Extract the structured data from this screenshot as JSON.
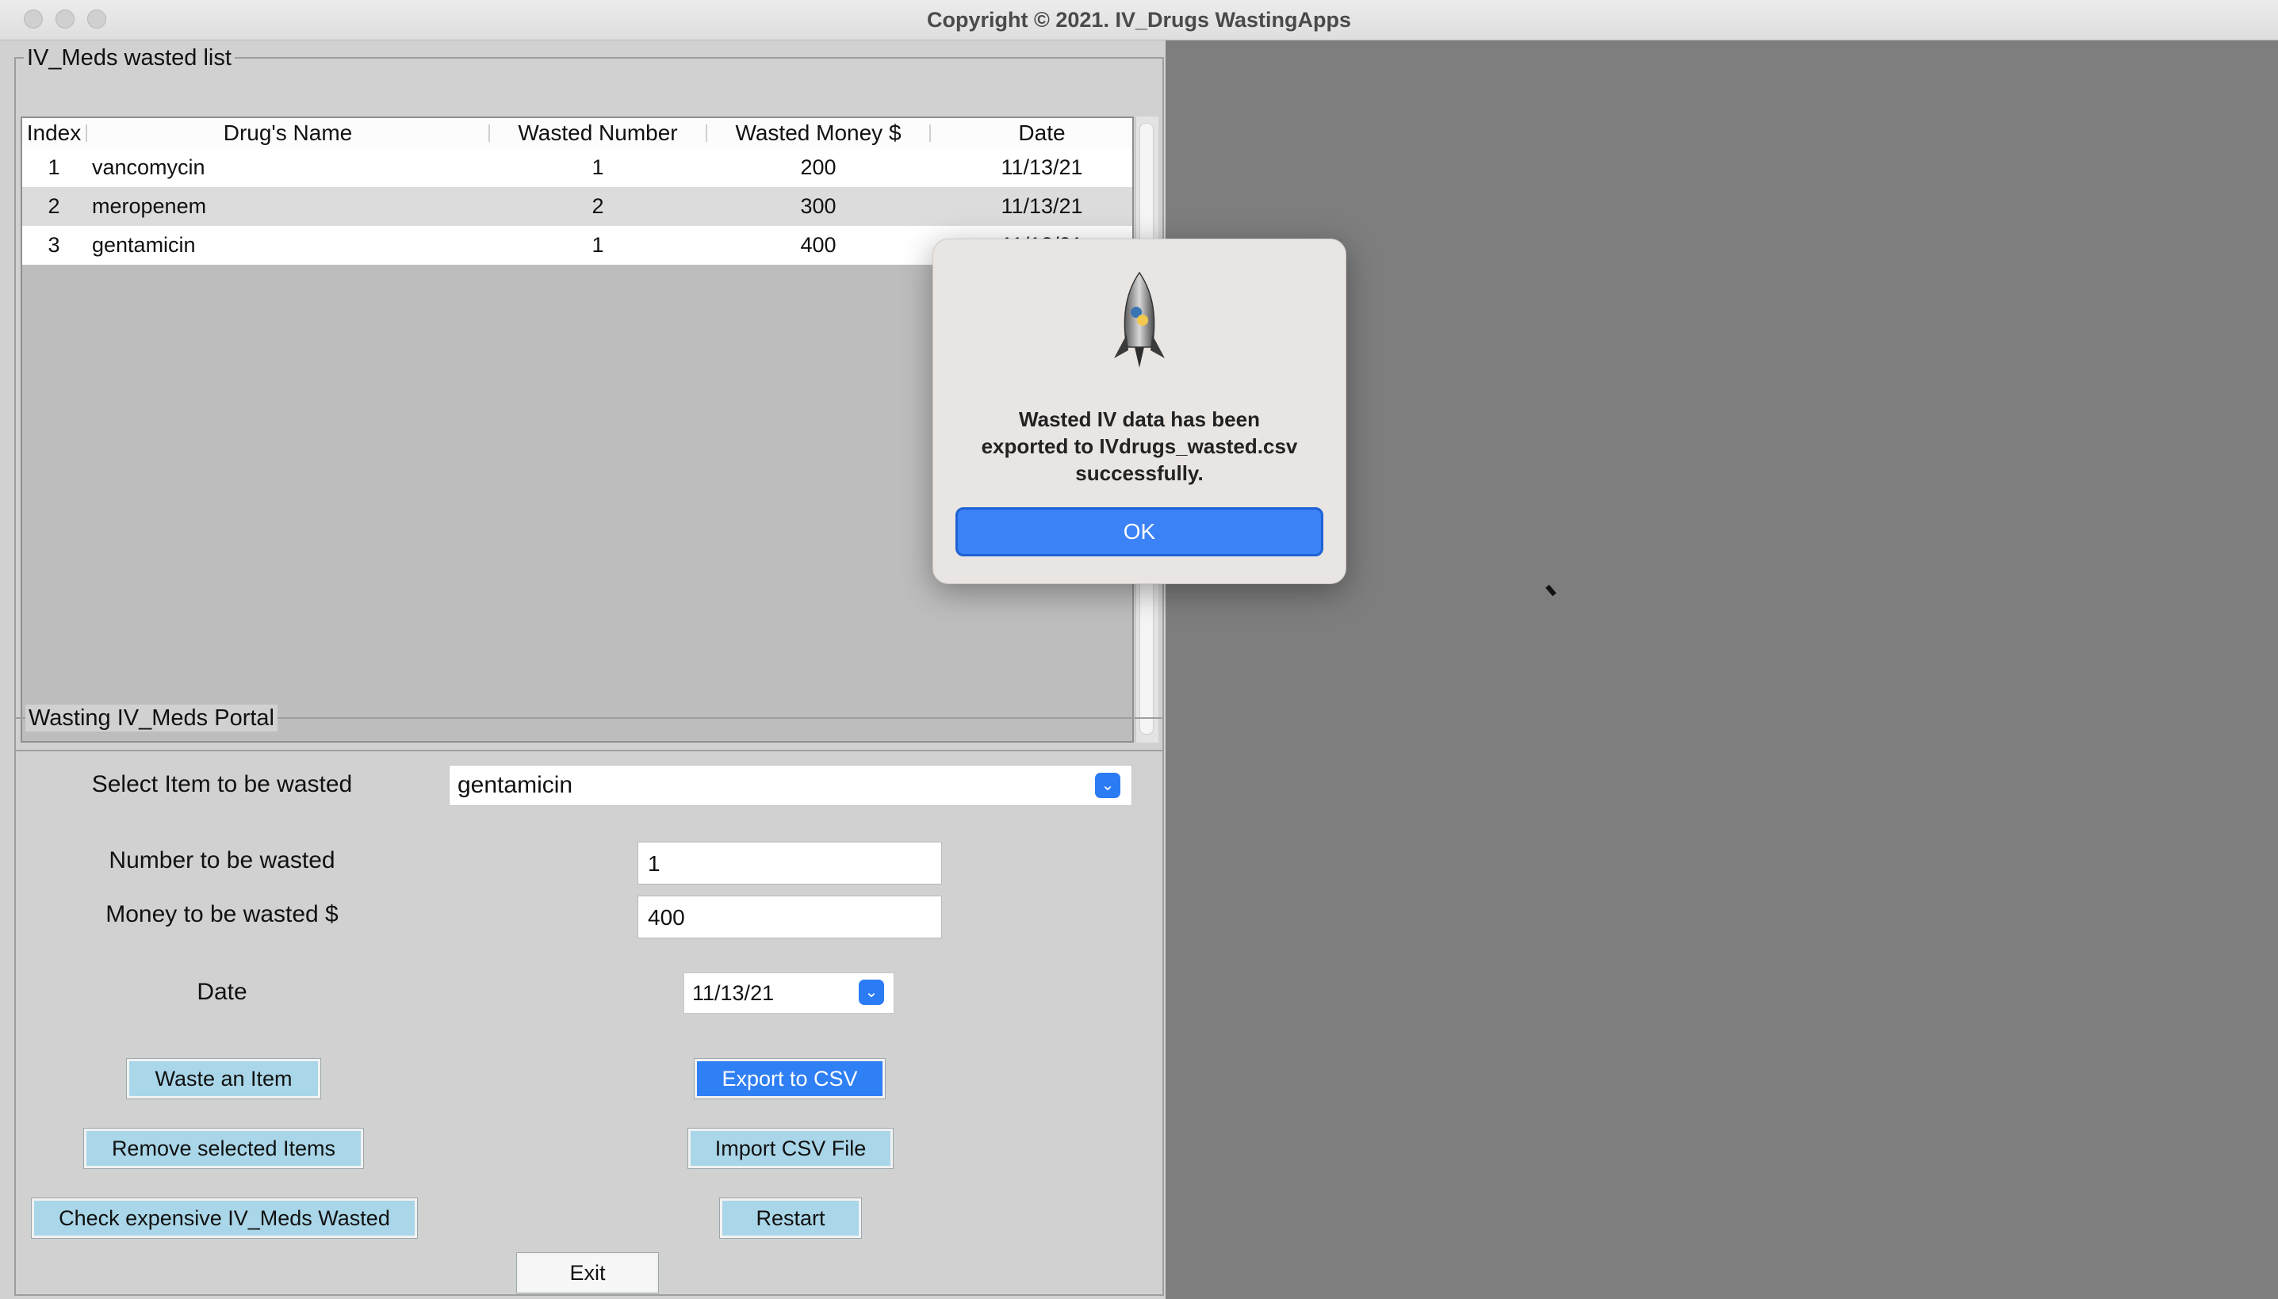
{
  "window": {
    "title": "Copyright © 2021. IV_Drugs WastingApps"
  },
  "list_group": {
    "label": "IV_Meds wasted list"
  },
  "table": {
    "columns": [
      "Index",
      "Drug's Name",
      "Wasted Number",
      "Wasted Money $",
      "Date"
    ],
    "rows": [
      {
        "index": "1",
        "name": "vancomycin",
        "number": "1",
        "money": "200",
        "date": "11/13/21"
      },
      {
        "index": "2",
        "name": "meropenem",
        "number": "2",
        "money": "300",
        "date": "11/13/21"
      },
      {
        "index": "3",
        "name": "gentamicin",
        "number": "1",
        "money": "400",
        "date": "11/13/21"
      }
    ]
  },
  "portal": {
    "label": "Wasting IV_Meds Portal",
    "select_label": "Select Item to be wasted",
    "select_value": "gentamicin",
    "number_label": "Number to be wasted",
    "number_value": "1",
    "money_label": "Money to be wasted $",
    "money_value": "400",
    "date_label": "Date",
    "date_value": "11/13/21"
  },
  "buttons": {
    "waste": "Waste an Item",
    "export": "Export to CSV",
    "remove": "Remove selected Items",
    "import": "Import CSV File",
    "check": "Check expensive IV_Meds Wasted",
    "restart": "Restart",
    "exit": "Exit"
  },
  "dialog": {
    "line1": "Wasted IV data has been",
    "line2": "exported to IVdrugs_wasted.csv",
    "line3": "successfully.",
    "ok": "OK",
    "icon": "python-rocket-icon"
  },
  "colors": {
    "accent": "#2f7ff5",
    "button_bg": "#a9d6e8",
    "panel": "#d1d1d1",
    "desktop": "#7e7e7e"
  }
}
